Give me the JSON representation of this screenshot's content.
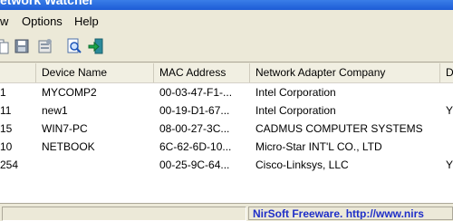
{
  "window": {
    "title": "etwork Watcher"
  },
  "menu": {
    "items": [
      "w",
      "Options",
      "Help"
    ]
  },
  "toolbar": {
    "buttons": [
      "copy-icon",
      "save-icon",
      "properties-icon",
      "find-icon",
      "exit-icon"
    ]
  },
  "table": {
    "columns": [
      "",
      "Device Name",
      "MAC Address",
      "Network Adapter Company",
      "D"
    ],
    "rows": [
      [
        "1",
        "MYCOMP2",
        "00-03-47-F1-...",
        "Intel Corporation",
        ""
      ],
      [
        "11",
        "new1",
        "00-19-D1-67...",
        "Intel Corporation",
        "Y"
      ],
      [
        "15",
        "WIN7-PC",
        "08-00-27-3C...",
        "CADMUS COMPUTER SYSTEMS",
        ""
      ],
      [
        "10",
        "NETBOOK",
        "6C-62-6D-10...",
        "Micro-Star INT'L CO., LTD",
        ""
      ],
      [
        "254",
        "",
        "00-25-9C-64...",
        "Cisco-Linksys, LLC",
        "Y"
      ]
    ]
  },
  "status": {
    "left": "",
    "link": "NirSoft Freeware.  http://www.nirs"
  },
  "colors": {
    "titlebar": "#1c5bd6",
    "link": "#1f2fc8"
  }
}
